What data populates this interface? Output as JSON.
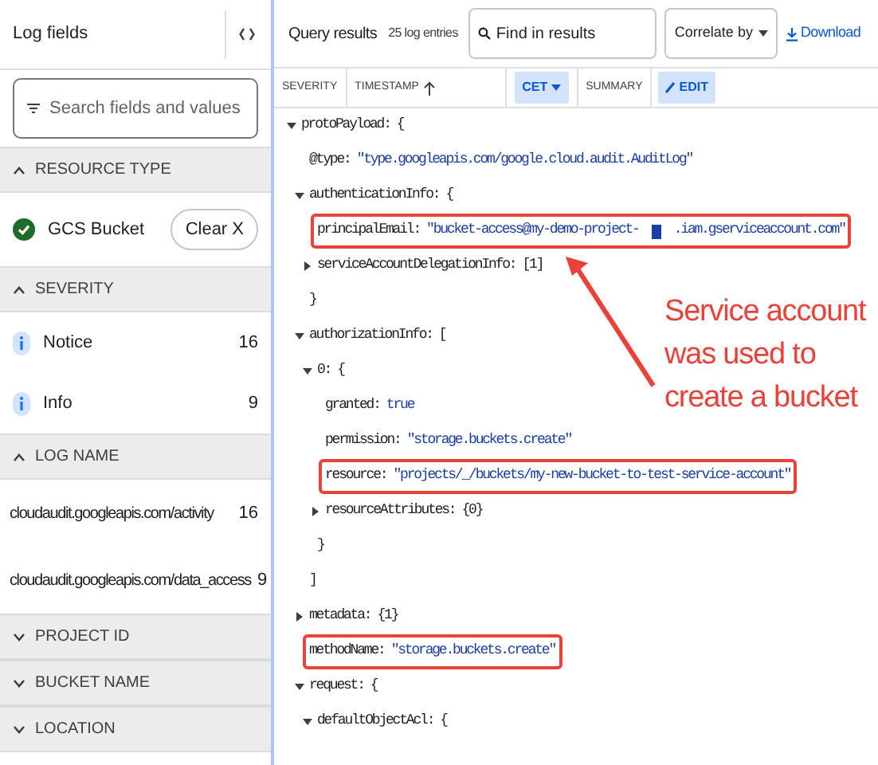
{
  "sidebar": {
    "title": "Log fields",
    "search": {
      "placeholder": "Search fields and values"
    },
    "sections": [
      {
        "title": "RESOURCE TYPE",
        "expanded": true,
        "items": [
          {
            "kind": "checked",
            "label": "GCS Bucket",
            "action": "Clear X"
          }
        ]
      },
      {
        "title": "SEVERITY",
        "expanded": true,
        "items": [
          {
            "kind": "severity",
            "label": "Notice",
            "count": "16"
          },
          {
            "kind": "severity",
            "label": "Info",
            "count": "9"
          }
        ]
      },
      {
        "title": "LOG NAME",
        "expanded": true,
        "items": [
          {
            "kind": "plain",
            "label": "cloudaudit.googleapis.com/activity",
            "count": "16"
          },
          {
            "kind": "plain",
            "label": "cloudaudit.googleapis.com/data_access",
            "count": "9"
          }
        ]
      },
      {
        "title": "PROJECT ID",
        "expanded": false
      },
      {
        "title": "BUCKET NAME",
        "expanded": false
      },
      {
        "title": "LOCATION",
        "expanded": false
      }
    ]
  },
  "results": {
    "title": "Query results",
    "count": "25 log entries",
    "search": {
      "placeholder": "Find in results"
    },
    "correlate": "Correlate by",
    "download": "Download",
    "columns": [
      {
        "kind": "label",
        "text": "SEVERITY"
      },
      {
        "kind": "sort",
        "text": "TIMESTAMP"
      },
      {
        "kind": "dropdown",
        "text": "CET"
      },
      {
        "kind": "label",
        "text": "SUMMARY"
      },
      {
        "kind": "edit",
        "text": "EDIT"
      }
    ]
  },
  "tree": [
    {
      "key": "protoPayload:",
      "open": "{",
      "expanded": true,
      "children": [
        {
          "key": "@type:",
          "value": "\"type.googleapis.com/google.cloud.audit.AuditLog\""
        },
        {
          "key": "authenticationInfo:",
          "open": "{",
          "expanded": true,
          "close": "}",
          "children": [
            {
              "key": "principalEmail:",
              "value": "\"bucket-access@my-demo-project-",
              "redacted": true,
              "value_after": ".iam.gserviceaccount.com\"",
              "highlighted": true
            },
            {
              "key": "serviceAccountDelegationInfo:",
              "open": "[1]",
              "expanded": false
            }
          ]
        },
        {
          "key": "authorizationInfo:",
          "open": "[",
          "expanded": true,
          "close": "]",
          "children": [
            {
              "key": "0:",
              "open": "{",
              "expanded": true,
              "close": "}",
              "children": [
                {
                  "key": "granted:",
                  "value": "true"
                },
                {
                  "key": "permission:",
                  "value": "\"storage.buckets.create\""
                },
                {
                  "key": "resource:",
                  "value": "\"projects/_/buckets/my-new-bucket-to-test-service-account\"",
                  "highlighted": true
                },
                {
                  "key": "resourceAttributes:",
                  "open": "{0}",
                  "expanded": false
                }
              ]
            }
          ]
        },
        {
          "key": "metadata:",
          "open": "{1}",
          "expanded": false
        },
        {
          "key": "methodName:",
          "value": "\"storage.buckets.create\"",
          "highlighted": true
        },
        {
          "key": "request:",
          "open": "{",
          "expanded": true,
          "children": [
            {
              "key": "defaultObjectAcl:",
              "open": "{",
              "expanded": true
            }
          ]
        }
      ]
    }
  ],
  "annotation": {
    "text": "Service account was used to create a bucket"
  }
}
